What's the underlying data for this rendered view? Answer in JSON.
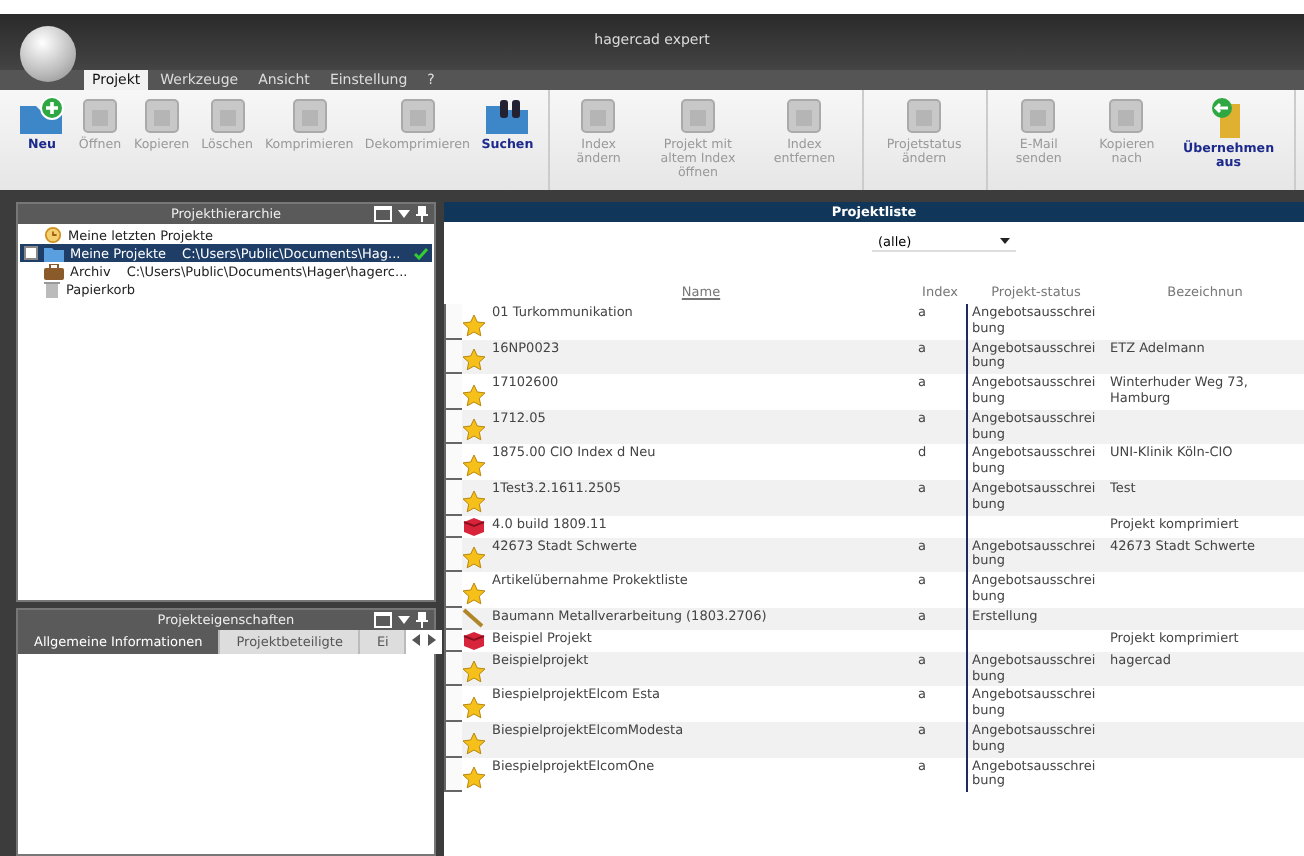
{
  "window": {
    "title": "hagercad expert"
  },
  "menu": [
    {
      "label": "Projekt",
      "selected": true
    },
    {
      "label": "Werkzeuge",
      "selected": false
    },
    {
      "label": "Ansicht",
      "selected": false
    },
    {
      "label": "Einstellung",
      "selected": false
    },
    {
      "label": "?",
      "selected": false
    }
  ],
  "ribbon": {
    "groups": [
      {
        "buttons": [
          {
            "label": "Neu",
            "disabled": false
          },
          {
            "label": "Öffnen",
            "disabled": true
          },
          {
            "label": "Kopieren",
            "disabled": true
          },
          {
            "label": "Löschen",
            "disabled": true
          },
          {
            "label": "Komprimieren",
            "disabled": true
          },
          {
            "label": "Dekomprimieren",
            "disabled": true
          },
          {
            "label": "Suchen",
            "disabled": false
          }
        ]
      },
      {
        "buttons": [
          {
            "label": "Index ändern",
            "disabled": true
          },
          {
            "label": "Projekt mit altem Index öffnen",
            "disabled": true
          },
          {
            "label": "Index entfernen",
            "disabled": true
          }
        ]
      },
      {
        "buttons": [
          {
            "label": "Projetstatus ändern",
            "disabled": true
          }
        ]
      },
      {
        "buttons": [
          {
            "label": "E-Mail senden",
            "disabled": true
          },
          {
            "label": "Kopieren nach",
            "disabled": true
          },
          {
            "label": "Übernehmen aus",
            "disabled": false
          }
        ]
      }
    ]
  },
  "hierarchy": {
    "title": "Projekthierarchie",
    "items": [
      {
        "kind": "recent",
        "label": "Meine letzten Projekte",
        "selected": false,
        "checked": false
      },
      {
        "kind": "folder",
        "label": "Meine Projekte",
        "path": "C:\\Users\\Public\\Documents\\Hag...",
        "selected": true,
        "checked": true
      },
      {
        "kind": "archive",
        "label": "Archiv",
        "path": "C:\\Users\\Public\\Documents\\Hager\\hagerc...",
        "selected": false,
        "checked": false
      },
      {
        "kind": "trash",
        "label": "Papierkorb",
        "selected": false,
        "checked": false
      }
    ]
  },
  "properties": {
    "title": "Projekteigenschaften",
    "tabs": [
      {
        "label": "Allgemeine Informationen",
        "selected": true
      },
      {
        "label": "Projektbeteiligte",
        "selected": false
      },
      {
        "label": "Ei",
        "selected": false
      }
    ]
  },
  "project_list": {
    "title": "Projektliste",
    "filter": "(alle)",
    "columns": [
      "Name",
      "Index",
      "Projekt-status",
      "Bezeichnun"
    ],
    "rows": [
      {
        "kind": "star",
        "name": "01 Turkommunikation",
        "index": "a",
        "status": "Angebotsausschreibung",
        "label": ""
      },
      {
        "kind": "star",
        "name": "16NP0023",
        "index": "a",
        "status": "Angebotsausschreibung",
        "label": "ETZ Adelmann"
      },
      {
        "kind": "star",
        "name": "17102600",
        "index": "a",
        "status": "Angebotsausschreibung",
        "label": "Winterhuder Weg 73, Hamburg"
      },
      {
        "kind": "star",
        "name": "1712.05",
        "index": "a",
        "status": "Angebotsausschreibung",
        "label": ""
      },
      {
        "kind": "star",
        "name": "1875.00 CIO Index d Neu",
        "index": "d",
        "status": "Angebotsausschreibung",
        "label": "UNI-Klinik Köln-CIO"
      },
      {
        "kind": "star",
        "name": "1Test3.2.1611.2505",
        "index": "a",
        "status": "Angebotsausschreibung",
        "label": "Test"
      },
      {
        "kind": "compressed",
        "name": "4.0 build 1809.11",
        "index": "",
        "status": "",
        "label": "Projekt komprimiert"
      },
      {
        "kind": "star",
        "name": "42673 Stadt Schwerte",
        "index": "a",
        "status": "Angebotsausschreibung",
        "label": "42673 Stadt Schwerte"
      },
      {
        "kind": "star",
        "name": "Artikelübernahme Prokektliste",
        "index": "a",
        "status": "Angebotsausschreibung",
        "label": ""
      },
      {
        "kind": "draft",
        "name": "Baumann Metallverarbeitung (1803.2706)",
        "index": "a",
        "status": "Erstellung",
        "label": ""
      },
      {
        "kind": "compressed",
        "name": "Beispiel Projekt",
        "index": "",
        "status": "",
        "label": "Projekt komprimiert"
      },
      {
        "kind": "star",
        "name": "Beispielprojekt",
        "index": "a",
        "status": "Angebotsausschreibung",
        "label": "hagercad"
      },
      {
        "kind": "star",
        "name": "BiespielprojektElcom Esta",
        "index": "a",
        "status": "Angebotsausschreibung",
        "label": ""
      },
      {
        "kind": "star",
        "name": "BiespielprojektElcomModesta",
        "index": "a",
        "status": "Angebotsausschreibung",
        "label": ""
      },
      {
        "kind": "star",
        "name": "BiespielprojektElcomOne",
        "index": "a",
        "status": "Angebotsausschreibung",
        "label": ""
      }
    ]
  }
}
